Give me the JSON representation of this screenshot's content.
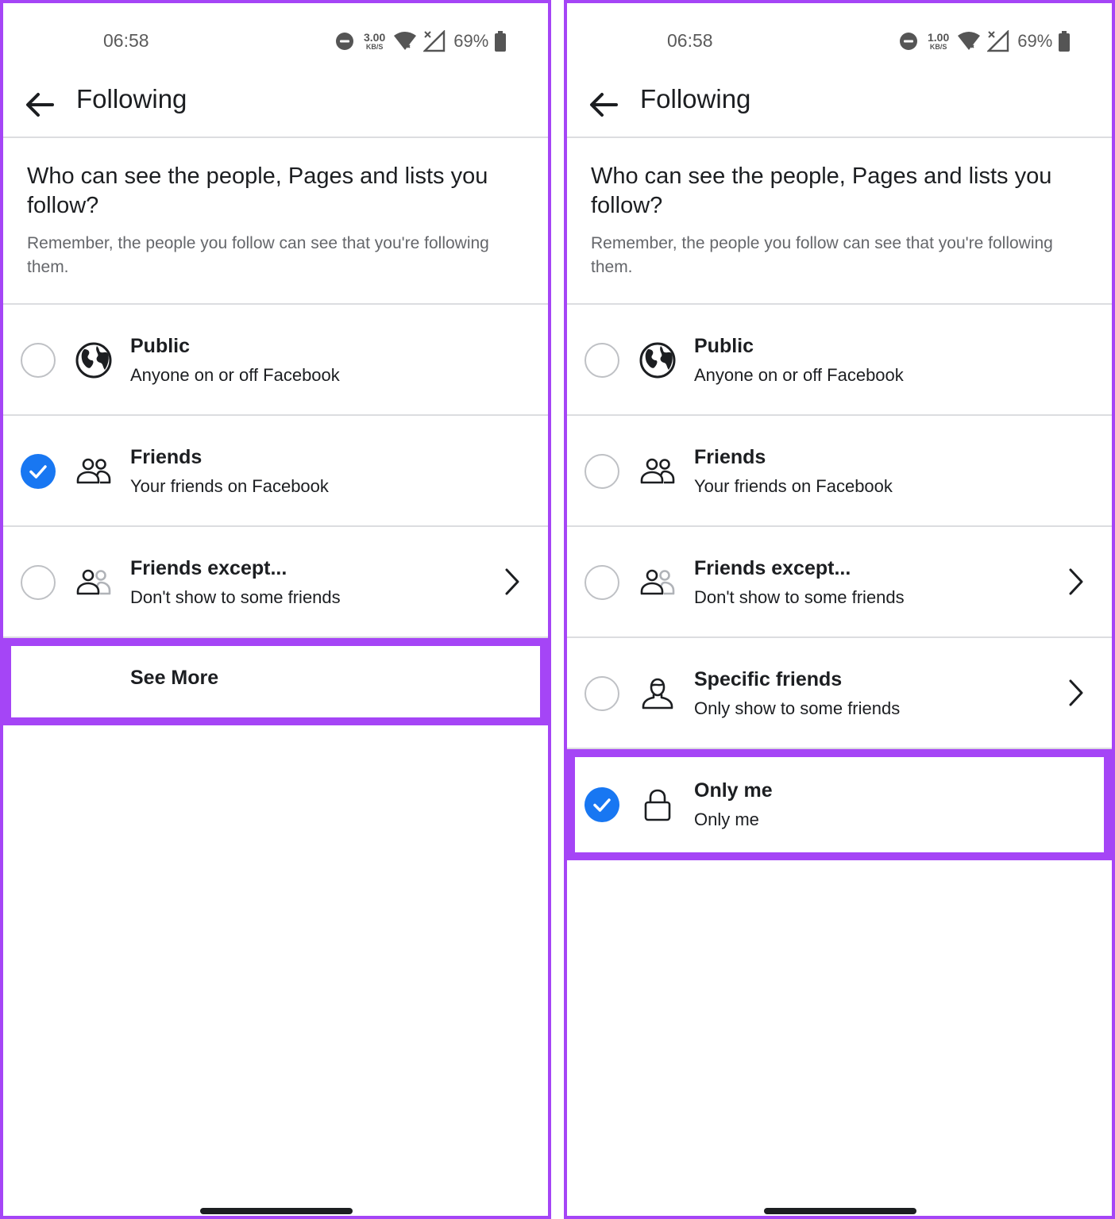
{
  "left": {
    "status": {
      "time": "06:58",
      "speed_value": "3.00",
      "speed_unit": "KB/S",
      "battery": "69%"
    },
    "appbar": {
      "title": "Following"
    },
    "question": {
      "title": "Who can see the people, Pages and lists you follow?",
      "description": "Remember, the people you follow can see that you're following them."
    },
    "options": [
      {
        "title": "Public",
        "subtitle": "Anyone on or off Facebook",
        "icon": "globe-icon",
        "checked": false
      },
      {
        "title": "Friends",
        "subtitle": "Your friends on Facebook",
        "icon": "friends-icon",
        "checked": true
      },
      {
        "title": "Friends except...",
        "subtitle": "Don't show to some friends",
        "icon": "friends-except-icon",
        "checked": false
      }
    ],
    "see_more": "See More"
  },
  "right": {
    "status": {
      "time": "06:58",
      "speed_value": "1.00",
      "speed_unit": "KB/S",
      "battery": "69%"
    },
    "appbar": {
      "title": "Following"
    },
    "question": {
      "title": "Who can see the people, Pages and lists you follow?",
      "description": "Remember, the people you follow can see that you're following them."
    },
    "options": [
      {
        "title": "Public",
        "subtitle": "Anyone on or off Facebook",
        "icon": "globe-icon",
        "checked": false
      },
      {
        "title": "Friends",
        "subtitle": "Your friends on Facebook",
        "icon": "friends-icon",
        "checked": false
      },
      {
        "title": "Friends except...",
        "subtitle": "Don't show to some friends",
        "icon": "friends-except-icon",
        "checked": false
      },
      {
        "title": "Specific friends",
        "subtitle": "Only show to some friends",
        "icon": "specific-friend-icon",
        "checked": false
      },
      {
        "title": "Only me",
        "subtitle": "Only me",
        "icon": "lock-icon",
        "checked": true
      }
    ]
  },
  "colors": {
    "accent": "#1877f2",
    "highlight": "#a545f6",
    "text": "#1c1e21",
    "secondary_text": "#65676b",
    "divider": "#dcdde0"
  }
}
